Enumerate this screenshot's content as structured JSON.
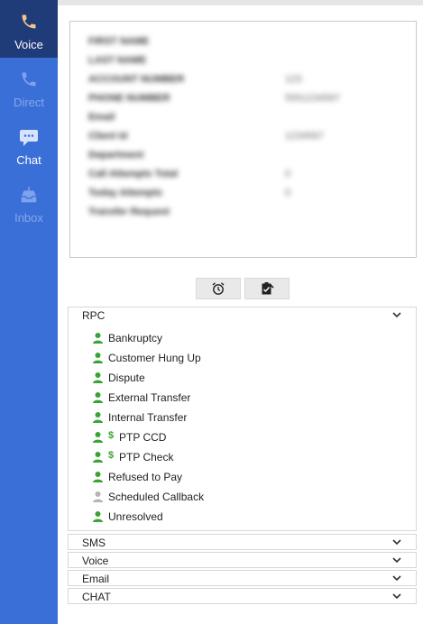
{
  "sidebar": {
    "items": [
      {
        "label": "Voice",
        "icon": "phone-icon",
        "state": "active"
      },
      {
        "label": "Direct",
        "icon": "phone-icon",
        "state": "disabled"
      },
      {
        "label": "Chat",
        "icon": "chat-icon",
        "state": "enabled"
      },
      {
        "label": "Inbox",
        "icon": "inbox-icon",
        "state": "disabled"
      }
    ]
  },
  "contact_info": {
    "fields": [
      {
        "label": "FIRST NAME",
        "value": ""
      },
      {
        "label": "LAST NAME",
        "value": ""
      },
      {
        "label": "ACCOUNT NUMBER",
        "value": "123"
      },
      {
        "label": "PHONE NUMBER",
        "value": "5551234567"
      },
      {
        "label": "Email",
        "value": ""
      },
      {
        "label": "Client Id",
        "value": "1234567"
      },
      {
        "label": "Department",
        "value": ""
      },
      {
        "label": "Call Attempts Total",
        "value": "0"
      },
      {
        "label": "Today Attempts",
        "value": "0"
      },
      {
        "label": "Transfer Request",
        "value": ""
      }
    ]
  },
  "actions": {
    "buttons": [
      {
        "icon": "alarm-clock-icon"
      },
      {
        "icon": "clipboard-check-icon"
      }
    ]
  },
  "dispositions": {
    "groups": [
      {
        "title": "RPC",
        "expanded": true,
        "items": [
          {
            "label": "Bankruptcy",
            "icon_color": "#3aa335",
            "dollar": false
          },
          {
            "label": "Customer Hung Up",
            "icon_color": "#3aa335",
            "dollar": false
          },
          {
            "label": "Dispute",
            "icon_color": "#3aa335",
            "dollar": false
          },
          {
            "label": "External Transfer",
            "icon_color": "#3aa335",
            "dollar": false
          },
          {
            "label": "Internal Transfer",
            "icon_color": "#3aa335",
            "dollar": false
          },
          {
            "label": "PTP CCD",
            "icon_color": "#3aa335",
            "dollar": true
          },
          {
            "label": "PTP Check",
            "icon_color": "#3aa335",
            "dollar": true
          },
          {
            "label": "Refused to Pay",
            "icon_color": "#3aa335",
            "dollar": false
          },
          {
            "label": "Scheduled Callback",
            "icon_color": "#b5b5b5",
            "dollar": false
          },
          {
            "label": "Unresolved",
            "icon_color": "#3aa335",
            "dollar": false
          }
        ]
      },
      {
        "title": "SMS",
        "expanded": false
      },
      {
        "title": "Voice",
        "expanded": false
      },
      {
        "title": "Email",
        "expanded": false
      },
      {
        "title": "CHAT",
        "expanded": false
      }
    ],
    "dollar_symbol": "$"
  },
  "colors": {
    "sidebar": "#3b6fd8",
    "sidebar_active": "#1f3b78",
    "accent_green": "#3aa335"
  }
}
